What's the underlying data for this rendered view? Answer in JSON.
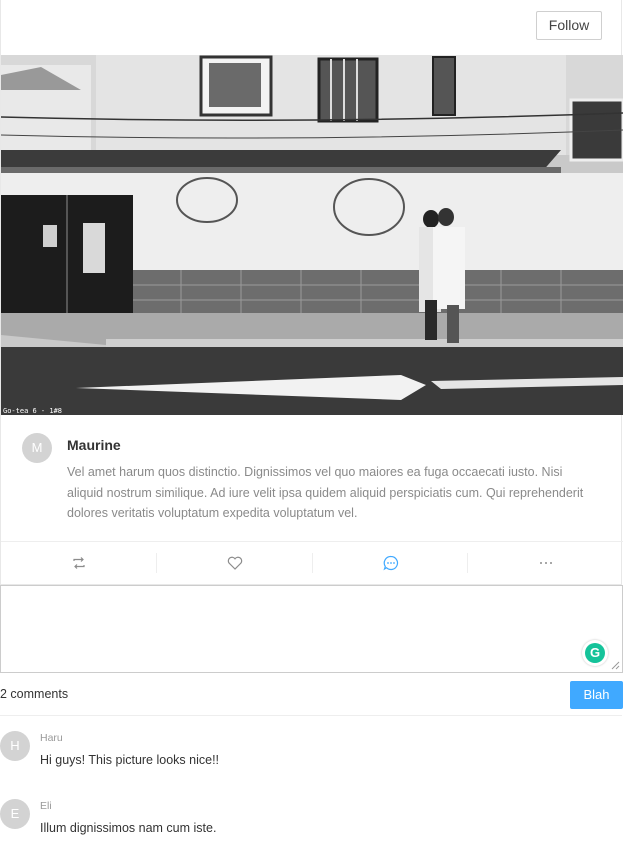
{
  "post": {
    "follow_label": "Follow",
    "photo_caption": "Go-tea 6 - 1#8",
    "author_initial": "M",
    "author_name": "Maurine",
    "text": "Vel amet harum quos distinctio. Dignissimos vel quo maiores ea fuga occaecati iusto. Nisi aliquid nostrum similique. Ad iure velit ipsa quidem aliquid perspiciatis cum. Qui reprehenderit dolores veritatis voluptatum expedita voluptatum vel.",
    "actions": [
      {
        "name": "retweet",
        "icon": "retweet-icon",
        "active": false
      },
      {
        "name": "like",
        "icon": "heart-icon",
        "active": false
      },
      {
        "name": "comment",
        "icon": "comment-icon",
        "active": true
      },
      {
        "name": "more",
        "icon": "ellipsis-icon",
        "active": false
      }
    ]
  },
  "composer": {
    "value": "",
    "grammarly_letter": "G",
    "submit_label": "Blah"
  },
  "comments": {
    "count_label": "2 comments",
    "items": [
      {
        "initial": "H",
        "author": "Haru",
        "text": "Hi guys! This picture looks nice!!"
      },
      {
        "initial": "E",
        "author": "Eli",
        "text": "Illum dignissimos nam cum iste."
      }
    ]
  },
  "colors": {
    "accent": "#40a9ff",
    "active_icon": "#40a9ff",
    "icon": "#8c8c8c",
    "avatar_bg": "#d3d3d3",
    "grammarly": "#15c39a"
  }
}
